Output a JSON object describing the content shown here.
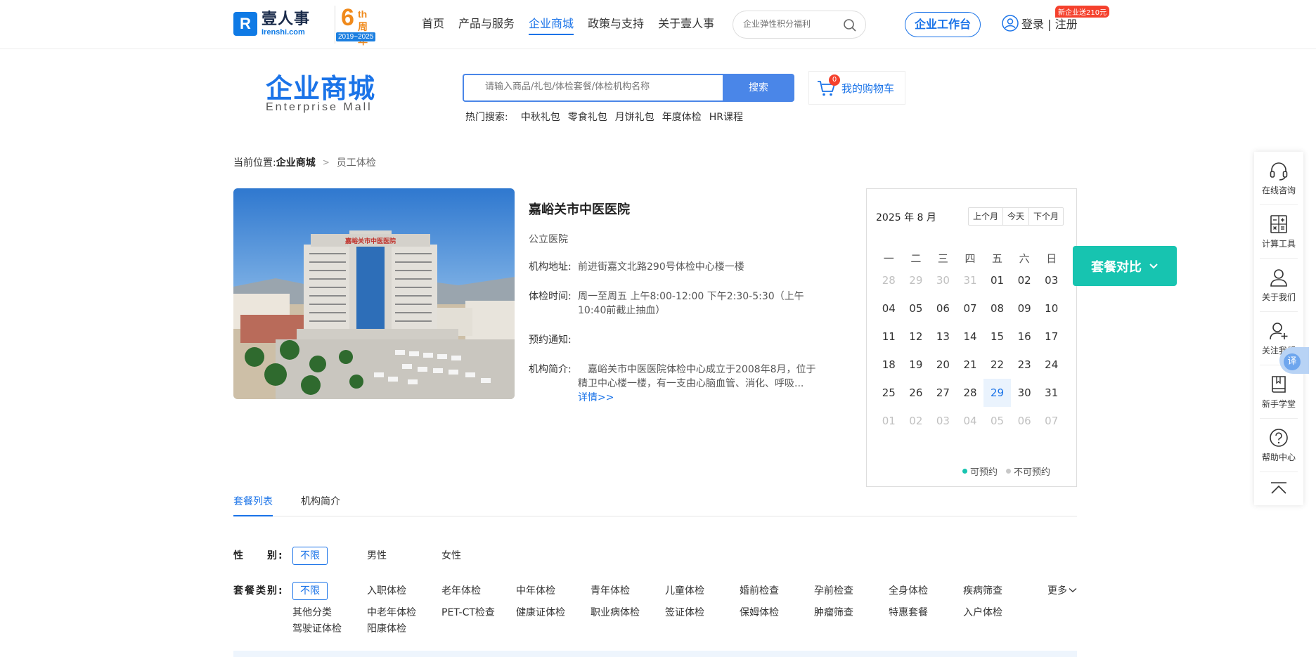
{
  "header": {
    "logo_mark": "R",
    "logo_cn": "壹人事",
    "logo_en": "Irenshi.com",
    "anniv_num": "6",
    "anniv_th": "th",
    "anniv_cn": "周年",
    "anniv_years": "2019~2025",
    "nav": [
      "首页",
      "产品与服务",
      "企业商城",
      "政策与支持",
      "关于壹人事"
    ],
    "nav_active": "企业商城",
    "search_placeholder": "企业弹性积分福利",
    "workbench": "企业工作台",
    "login": "登录 | 注册",
    "promo": "新企业送210元"
  },
  "mall": {
    "title": "企业商城",
    "subtitle": "Enterprise  Mall",
    "search_placeholder": "请输入商品/礼包/体检套餐/体检机构名称",
    "search_button": "搜索",
    "cart_count": "0",
    "cart_label": "我的购物车",
    "hot_label": "热门搜索:",
    "hot_items": [
      "中秋礼包",
      "零食礼包",
      "月饼礼包",
      "年度体检",
      "HR课程"
    ]
  },
  "breadcrumb": {
    "prefix": "当前位置:",
    "level1": "企业商城",
    "level2": "员工体检"
  },
  "hospital": {
    "name": "嘉峪关市中医医院",
    "sign": "嘉峪关市中医医院",
    "type": "公立医院",
    "address_label": "机构地址:",
    "address": "前进街嘉文北路290号体检中心楼一楼",
    "hours_label": "体检时间:",
    "hours": "周一至周五 上午8:00-12:00 下午2:30-5:30（上午10:40前截止抽血）",
    "notice_label": "预约通知:",
    "notice": "",
    "intro_label": "机构简介:",
    "intro": "　嘉峪关市中医医院体检中心成立于2008年8月，位于精卫中心楼一楼，有一支由心脑血管、消化、呼吸...",
    "detail_link": "详情>>"
  },
  "calendar": {
    "title": "2025 年 8 月",
    "prev": "上个月",
    "today": "今天",
    "next": "下个月",
    "weekdays": [
      "一",
      "二",
      "三",
      "四",
      "五",
      "六",
      "日"
    ],
    "weeks": [
      [
        "28",
        "29",
        "30",
        "31",
        "01",
        "02",
        "03"
      ],
      [
        "04",
        "05",
        "06",
        "07",
        "08",
        "09",
        "10"
      ],
      [
        "11",
        "12",
        "13",
        "14",
        "15",
        "16",
        "17"
      ],
      [
        "18",
        "19",
        "20",
        "21",
        "22",
        "23",
        "24"
      ],
      [
        "25",
        "26",
        "27",
        "28",
        "29",
        "30",
        "31"
      ],
      [
        "01",
        "02",
        "03",
        "04",
        "05",
        "06",
        "07"
      ]
    ],
    "today_date": "29",
    "legend_available": "可预约",
    "legend_unavailable": "不可预约",
    "color_available": "#17c4b0",
    "color_unavailable": "#c8c8c8"
  },
  "compare_button": "套餐对比",
  "float_bar": [
    "在线咨询",
    "计算工具",
    "关于我们",
    "关注我们",
    "新手学堂",
    "帮助中心"
  ],
  "float_icons": [
    "headset-icon",
    "calculator-icon",
    "user-icon",
    "user-add-icon",
    "book-icon",
    "help-icon",
    "back-to-top-icon"
  ],
  "translate": "译",
  "tabs": [
    "套餐列表",
    "机构简介"
  ],
  "filters": {
    "gender_label": "性　　别:",
    "gender_all": "不限",
    "gender_options": [
      "男性",
      "女性"
    ],
    "category_label": "套餐类别:",
    "category_all": "不限",
    "category_row1": [
      "入职体检",
      "老年体检",
      "中年体检",
      "青年体检",
      "儿童体检",
      "婚前检查",
      "孕前检查",
      "全身体检",
      "疾病筛查"
    ],
    "category_row2": [
      "其他分类",
      "中老年体检",
      "PET-CT检查",
      "健康证体检",
      "职业病体检",
      "签证体检",
      "保姆体检",
      "肿瘤筛查",
      "特惠套餐",
      "入户体检"
    ],
    "category_row3": [
      "驾驶证体检",
      "阳康体检"
    ],
    "more": "更多"
  }
}
